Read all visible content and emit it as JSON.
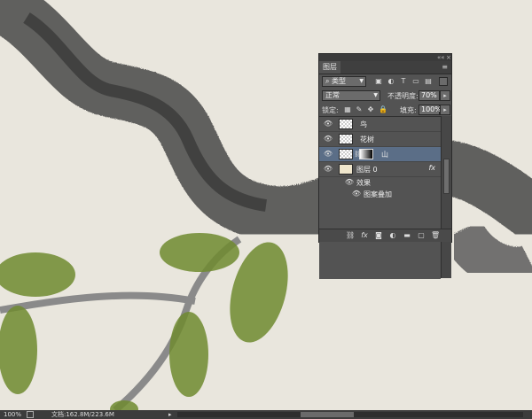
{
  "panel": {
    "tab": "图层",
    "kind_filter": "类型",
    "blend_mode": "正常",
    "opacity_label": "不透明度:",
    "opacity_value": "70%",
    "lock_label": "锁定:",
    "fill_label": "填充:",
    "fill_value": "100%"
  },
  "layers": [
    {
      "name": "鸟"
    },
    {
      "name": "花树"
    },
    {
      "name": "山",
      "selected": true
    },
    {
      "name": "图层 0",
      "fx": "fx"
    }
  ],
  "effects": {
    "label": "效果",
    "items": [
      "图案叠加"
    ]
  },
  "status": {
    "zoom": "100%",
    "doc": "文档:162.8M/223.6M"
  },
  "colors": {
    "panel_bg": "#535353",
    "selected_layer": "#5b6e87",
    "canvas_bg": "#e9e6dd",
    "leaf_green": "#6f8a2f",
    "branch_gray": "#5a5a5a"
  }
}
